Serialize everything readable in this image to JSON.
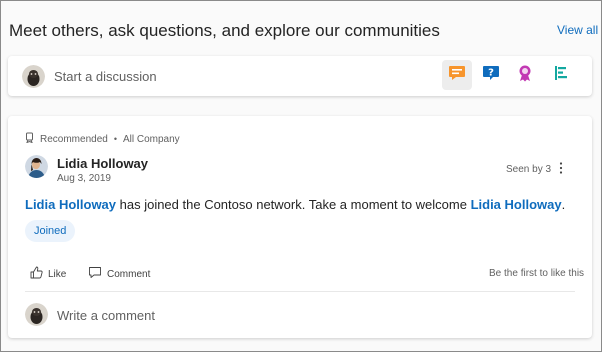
{
  "header": {
    "title": "Meet others, ask questions, and explore our communities",
    "view_all": "View all"
  },
  "composer": {
    "placeholder": "Start a discussion",
    "post_types": [
      {
        "name": "discussion",
        "icon": "chat-bubble-icon",
        "color": "#f7952c",
        "active": true
      },
      {
        "name": "question",
        "icon": "question-icon",
        "color": "#0f6cbd",
        "active": false
      },
      {
        "name": "praise",
        "icon": "ribbon-icon",
        "color": "#c239b3",
        "active": false
      },
      {
        "name": "poll",
        "icon": "poll-icon",
        "color": "#13a8a0",
        "active": false
      }
    ]
  },
  "post": {
    "meta": {
      "recommended": "Recommended",
      "community": "All Company"
    },
    "author": {
      "name": "Lidia Holloway",
      "date": "Aug 3, 2019"
    },
    "seen_by": "Seen by 3",
    "body": {
      "mention_1": "Lidia Holloway",
      "text": " has joined the Contoso network. Take a moment to welcome ",
      "mention_2": "Lidia Holloway",
      "end": "."
    },
    "badge": "Joined",
    "actions": {
      "like": "Like",
      "comment": "Comment"
    },
    "like_status": "Be the first to like this",
    "comment_placeholder": "Write a comment"
  },
  "colors": {
    "accent": "#0f6cbd",
    "badge_bg": "#ebf3fc"
  }
}
